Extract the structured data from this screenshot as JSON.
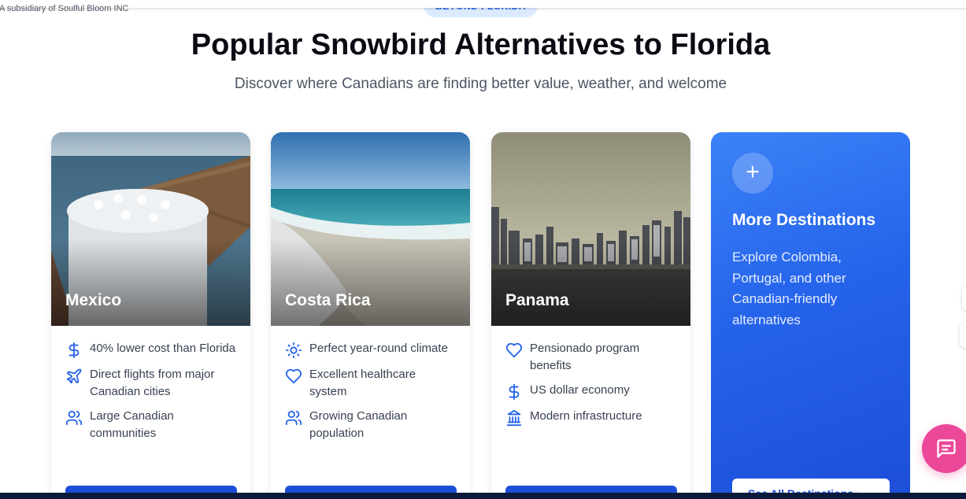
{
  "header": {
    "subsidiary": "A subsidiary of Soulful Bloom INC",
    "badge": "BEYOND FLORIDA"
  },
  "section": {
    "title": "Popular Snowbird Alternatives to Florida",
    "subtitle": "Discover where Canadians are finding better value, weather, and welcome"
  },
  "destinations": [
    {
      "name": "Mexico",
      "features": [
        {
          "icon": "dollar-icon",
          "text": "40% lower cost than Florida"
        },
        {
          "icon": "plane-icon",
          "text": "Direct flights from major Canadian cities"
        },
        {
          "icon": "users-icon",
          "text": "Large Canadian communities"
        }
      ]
    },
    {
      "name": "Costa Rica",
      "features": [
        {
          "icon": "sun-icon",
          "text": "Perfect year-round climate"
        },
        {
          "icon": "heart-icon",
          "text": "Excellent healthcare system"
        },
        {
          "icon": "users-icon",
          "text": "Growing Canadian population"
        }
      ]
    },
    {
      "name": "Panama",
      "features": [
        {
          "icon": "heart-icon",
          "text": "Pensionado program benefits"
        },
        {
          "icon": "dollar-icon",
          "text": "US dollar economy"
        },
        {
          "icon": "bank-icon",
          "text": "Modern infrastructure"
        }
      ]
    }
  ],
  "more": {
    "icon": "plus-icon",
    "plus_glyph": "+",
    "title": "More Destinations",
    "description": "Explore Colombia, Portugal, and other Canadian-friendly alternatives",
    "button_label": "See All Destinations ›"
  },
  "chat": {
    "icon": "chat-icon"
  },
  "colors": {
    "primary": "#1d4ed8",
    "accent_blue": "#2563eb",
    "chat_pink": "#ec4899",
    "icon_blue": "#2563eb"
  }
}
